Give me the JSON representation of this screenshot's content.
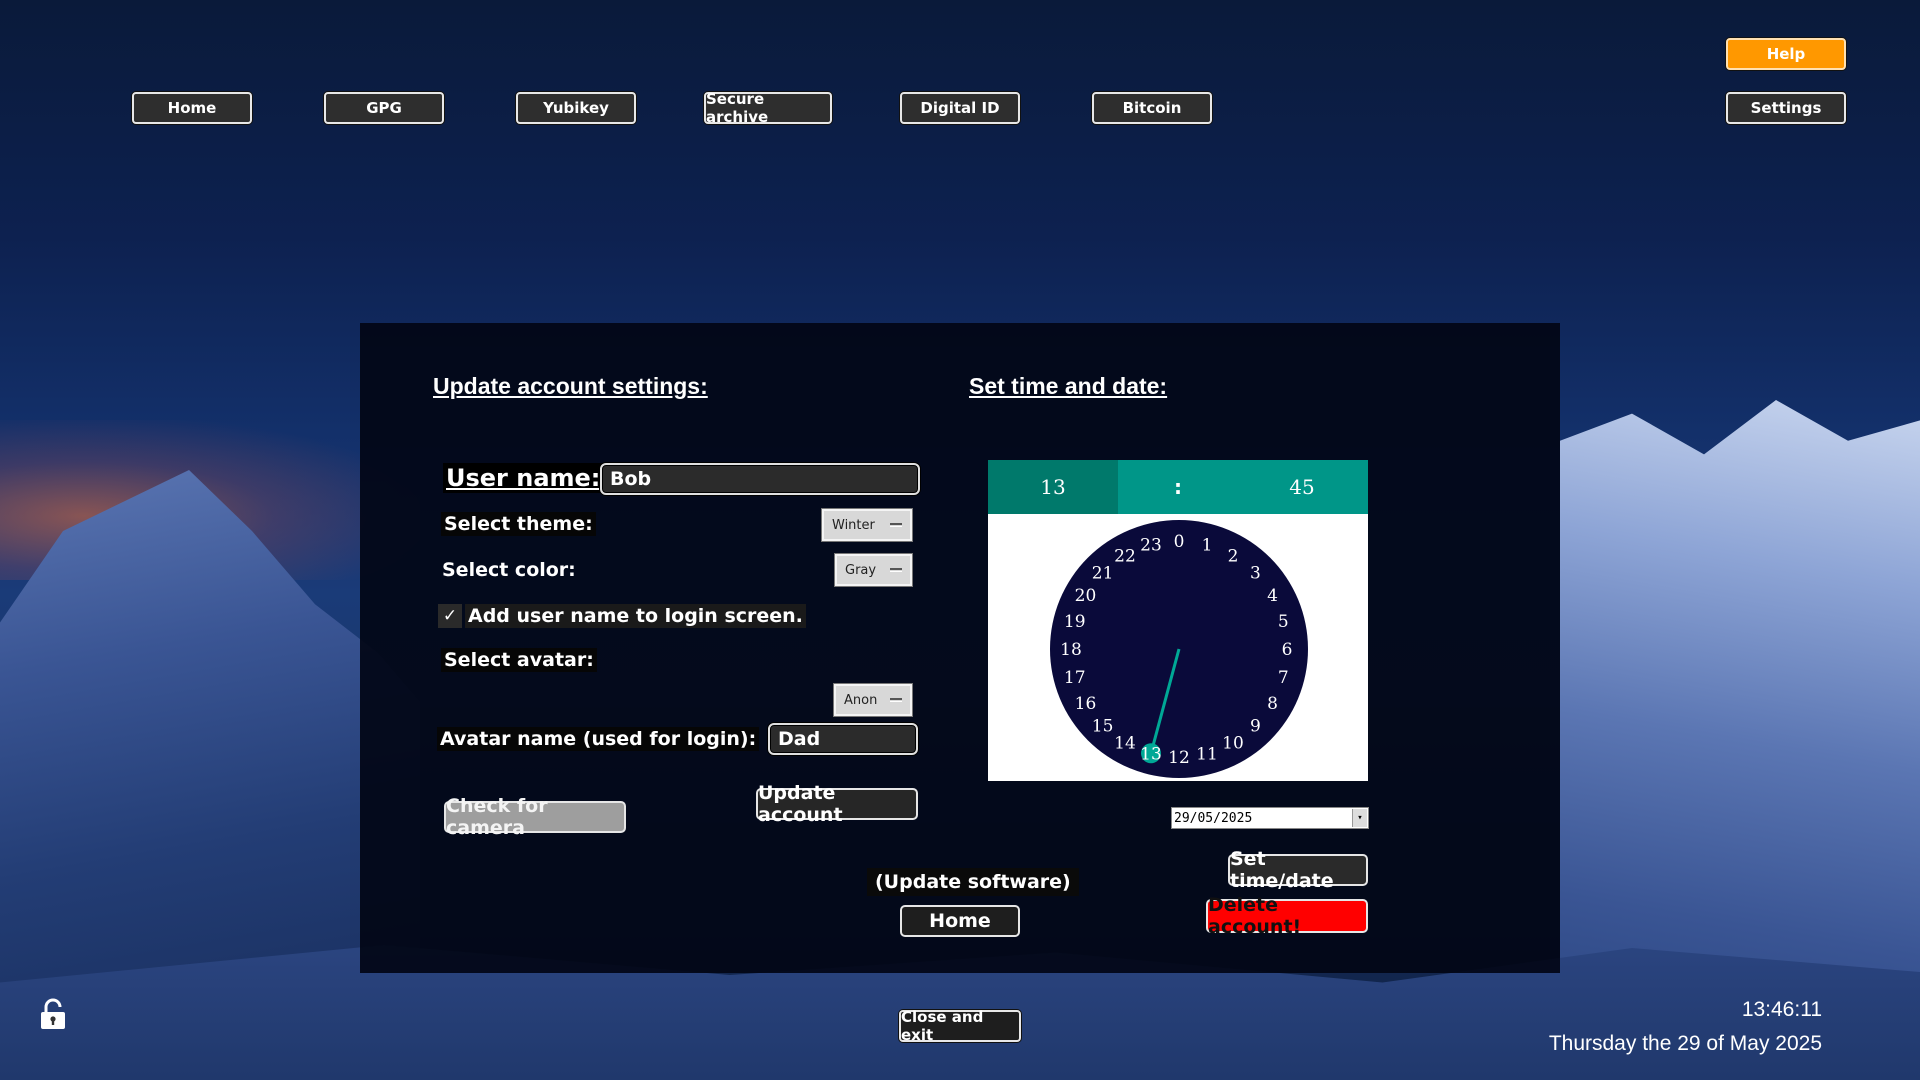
{
  "nav": {
    "home": "Home",
    "gpg": "GPG",
    "yubikey": "Yubikey",
    "secure_archive": "Secure archive",
    "digital_id": "Digital ID",
    "bitcoin": "Bitcoin",
    "help": "Help",
    "settings": "Settings"
  },
  "account": {
    "heading": "Update account settings:",
    "username_label": "User name:",
    "username_value": "Bob",
    "theme_label": "Select theme:",
    "theme_value": "Winter",
    "color_label": "Select color:",
    "color_value": "Gray",
    "login_checkbox_label": "Add user name to login screen.",
    "login_checkbox_checked": true,
    "avatar_label": "Select avatar:",
    "avatar_value": "Anon",
    "avatar_name_label": "Avatar name (used for login):",
    "avatar_name_value": "Dad",
    "check_camera": "Check for camera",
    "update_account": "Update account",
    "update_software": "(Update software)",
    "home": "Home"
  },
  "time": {
    "heading": "Set time and date:",
    "hour": "13",
    "separator": ":",
    "minute": "45",
    "selected_hour": "13",
    "date_value": "29/05/2025",
    "set_button": "Set time/date",
    "delete_button": "Delete account!"
  },
  "footer": {
    "close_exit": "Close and exit",
    "clock_time": "13:46:11",
    "clock_date": "Thursday the 29 of May 2025"
  },
  "colors": {
    "teal": "#009688",
    "danger": "#ff0000",
    "help": "#ff9800",
    "clock_face": "#0a0a3a"
  }
}
